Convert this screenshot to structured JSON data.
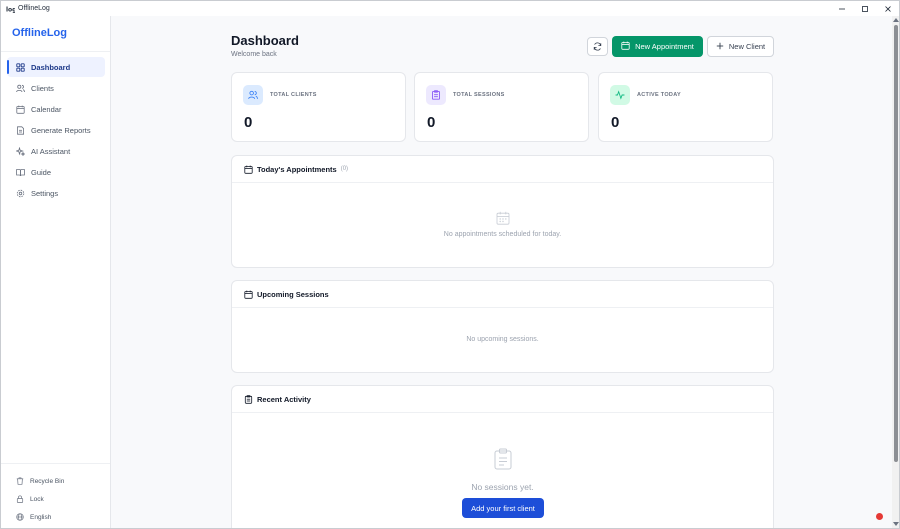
{
  "window": {
    "title": "OfflineLog",
    "app_icon": "log-icon"
  },
  "sidebar": {
    "brand": "OfflineLog",
    "items": [
      {
        "label": "Dashboard",
        "icon": "grid-icon",
        "active": true
      },
      {
        "label": "Clients",
        "icon": "users-icon"
      },
      {
        "label": "Calendar",
        "icon": "calendar-icon"
      },
      {
        "label": "Generate Reports",
        "icon": "report-icon"
      },
      {
        "label": "AI Assistant",
        "icon": "sparkles-icon"
      },
      {
        "label": "Guide",
        "icon": "book-icon"
      },
      {
        "label": "Settings",
        "icon": "gear-icon"
      }
    ],
    "bottom": [
      {
        "label": "Recycle Bin",
        "icon": "trash-icon"
      },
      {
        "label": "Lock",
        "icon": "lock-icon"
      },
      {
        "label": "English",
        "icon": "globe-icon"
      }
    ]
  },
  "header": {
    "title": "Dashboard",
    "subtitle": "Welcome back",
    "new_appointment": "New Appointment",
    "new_client": "New Client"
  },
  "stats": [
    {
      "label": "TOTAL CLIENTS",
      "value": "0",
      "icon": "users-icon",
      "color": "#3b82f6"
    },
    {
      "label": "TOTAL SESSIONS",
      "value": "0",
      "icon": "clipboard-icon",
      "color": "#8b5cf6"
    },
    {
      "label": "ACTIVE TODAY",
      "value": "0",
      "icon": "activity-icon",
      "color": "#10b981"
    }
  ],
  "panels": {
    "today": {
      "title": "Today's Appointments",
      "count": "(0)",
      "empty": "No appointments scheduled for today."
    },
    "upcoming": {
      "title": "Upcoming Sessions",
      "empty": "No upcoming sessions."
    },
    "recent": {
      "title": "Recent Activity",
      "empty": "No sessions yet.",
      "cta": "Add your first client"
    }
  },
  "colors": {
    "primary": "#2563eb",
    "success": "#059669",
    "cta": "#1d4ed8"
  }
}
